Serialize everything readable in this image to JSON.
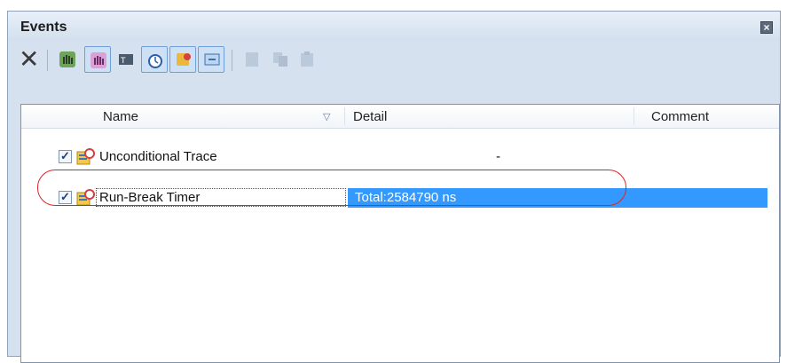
{
  "window": {
    "title": "Events"
  },
  "toolbar": {
    "buttons": [
      {
        "icon": "delete-icon",
        "state": "normal"
      },
      {
        "icon": "hardware-break-icon",
        "state": "normal"
      },
      {
        "icon": "software-break-icon",
        "state": "checked"
      },
      {
        "icon": "trace-icon",
        "state": "normal"
      },
      {
        "icon": "timer-icon",
        "state": "checked"
      },
      {
        "icon": "event-mark-icon",
        "state": "checked"
      },
      {
        "icon": "action-event-icon",
        "state": "checked"
      },
      {
        "icon": "detail-icon",
        "state": "disabled"
      },
      {
        "icon": "copy-icon",
        "state": "disabled"
      },
      {
        "icon": "paste-icon",
        "state": "disabled"
      }
    ],
    "delete_glyph": "✕"
  },
  "columns": {
    "name": "Name",
    "detail": "Detail",
    "comment": "Comment",
    "sort_glyph": "▽"
  },
  "rows": [
    {
      "checked": true,
      "name": "Unconditional Trace",
      "detail": "-",
      "comment": "",
      "selected": false
    },
    {
      "checked": true,
      "name": "Run-Break Timer",
      "detail": "Total:2584790 ns",
      "comment": "",
      "selected": true
    }
  ],
  "check_glyph": "✓",
  "colors": {
    "selection": "#3399ff",
    "highlight": "#e0202a"
  }
}
